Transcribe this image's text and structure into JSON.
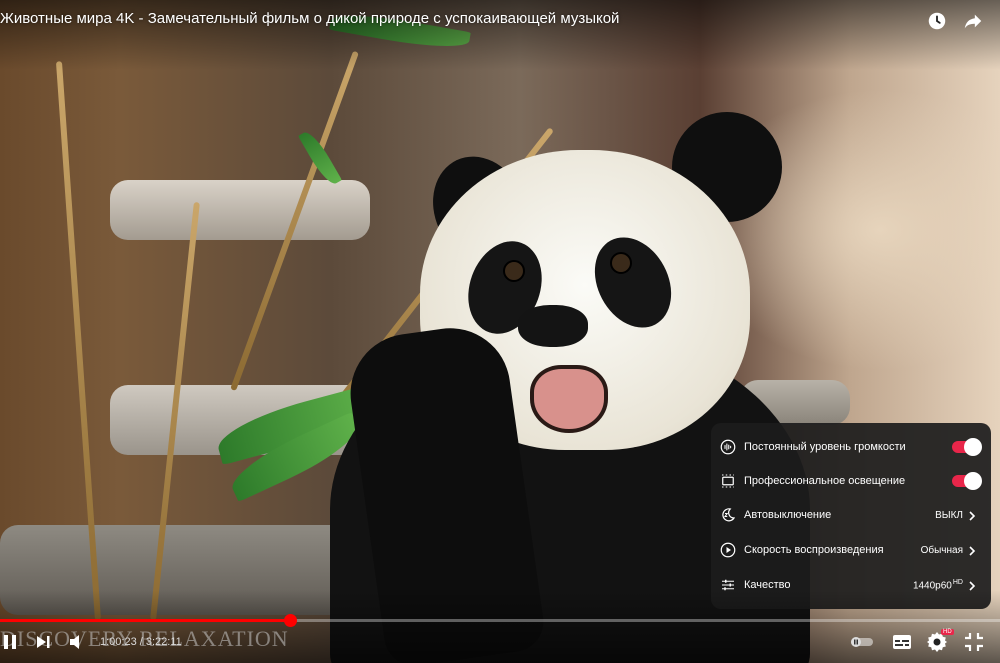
{
  "video": {
    "title": "Животные мира 4K - Замечательный фильм о дикой природе с успокаивающей музыкой",
    "watermark": "DISCOVERY RELAXATION"
  },
  "top_bar": {
    "watch_later_icon": "clock-icon",
    "share_icon": "share-arrow-icon"
  },
  "settings_menu": {
    "items": [
      {
        "label": "Постоянный уровень громкости",
        "icon": "volume-level-icon",
        "control": "toggle",
        "state": "on",
        "value": ""
      },
      {
        "label": "Профессиональное освещение",
        "icon": "ambient-mode-icon",
        "control": "toggle",
        "state": "on",
        "value": ""
      },
      {
        "label": "Автовыключение",
        "icon": "sleep-timer-icon",
        "control": "submenu",
        "value": "ВЫКЛ"
      },
      {
        "label": "Скорость воспроизведения",
        "icon": "playback-speed-icon",
        "control": "submenu",
        "value": "Обычная"
      },
      {
        "label": "Качество",
        "icon": "quality-sliders-icon",
        "control": "submenu",
        "value": "1440p60",
        "badge": "HD"
      }
    ],
    "toggle_color": "#e8264a"
  },
  "controls": {
    "current_time": "1:00:23",
    "separator": " / ",
    "duration": "3:22:11",
    "progress_fraction": 0.29,
    "progress_color": "#ff0000",
    "settings_badge": "HD",
    "icons": [
      "pause-icon",
      "next-icon",
      "volume-icon",
      "autoplay-toggle-icon",
      "subtitles-icon",
      "settings-gear-icon",
      "exit-fullscreen-icon"
    ]
  }
}
